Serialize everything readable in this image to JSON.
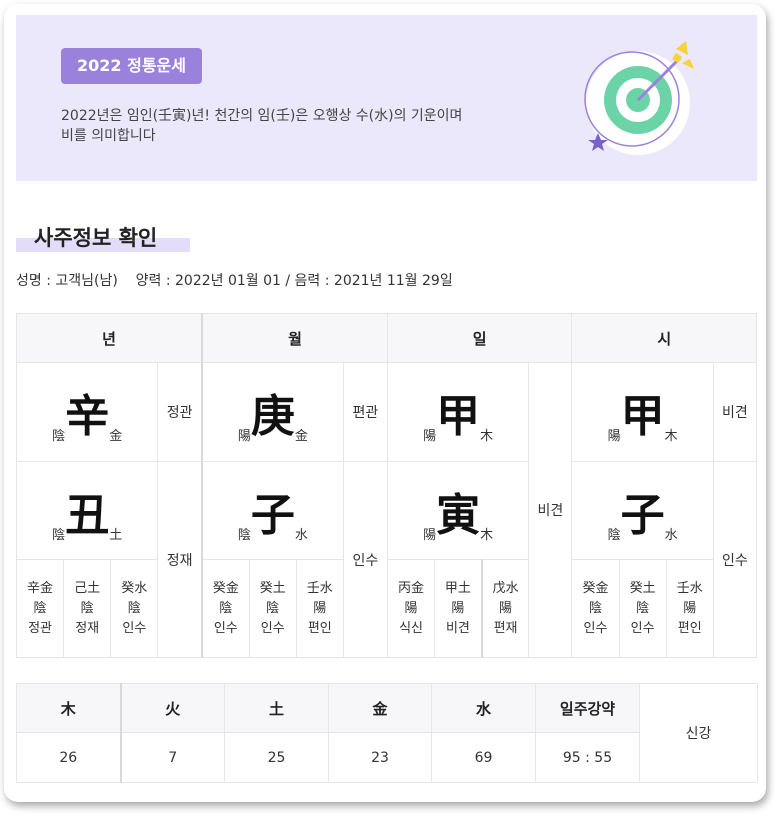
{
  "banner": {
    "badge": "2022 정통운세",
    "text_line1": "2022년은 임인(壬寅)년! 천간의 임(壬)은 오행상 수(水)의 기운이며",
    "text_line2": "비를 의미합니다"
  },
  "section": {
    "title": "사주정보 확인",
    "info": "성명 : 고객님(남)    양력 : 2022년 01월 01 / 음력 : 2021년 11월 29일"
  },
  "pillars": [
    {
      "header": "년",
      "stem": {
        "yin": "陰",
        "char": "辛",
        "elem": "金",
        "ten": "정관"
      },
      "branch": {
        "yin": "陰",
        "char": "丑",
        "elem": "土",
        "ten": "정재"
      },
      "hidden": [
        {
          "a": "辛金",
          "b": "陰",
          "c": "정관"
        },
        {
          "a": "己土",
          "b": "陰",
          "c": "정재"
        },
        {
          "a": "癸水",
          "b": "陰",
          "c": "인수"
        }
      ]
    },
    {
      "header": "월",
      "stem": {
        "yin": "陽",
        "char": "庚",
        "elem": "金",
        "ten": "편관"
      },
      "branch": {
        "yin": "陰",
        "char": "子",
        "elem": "水",
        "ten": "인수"
      },
      "hidden": [
        {
          "a": "癸金",
          "b": "陰",
          "c": "인수"
        },
        {
          "a": "癸土",
          "b": "陰",
          "c": "인수"
        },
        {
          "a": "壬水",
          "b": "陽",
          "c": "편인"
        }
      ]
    },
    {
      "header": "일",
      "stem": {
        "yin": "陽",
        "char": "甲",
        "elem": "木",
        "ten": ""
      },
      "branch": {
        "yin": "陽",
        "char": "寅",
        "elem": "木",
        "ten": "비견"
      },
      "hidden": [
        {
          "a": "丙金",
          "b": "陽",
          "c": "식신"
        },
        {
          "a": "甲土",
          "b": "陽",
          "c": "비견"
        },
        {
          "a": "戊水",
          "b": "陽",
          "c": "편재"
        }
      ]
    },
    {
      "header": "시",
      "stem": {
        "yin": "陽",
        "char": "甲",
        "elem": "木",
        "ten": "비견"
      },
      "branch": {
        "yin": "陰",
        "char": "子",
        "elem": "水",
        "ten": "인수"
      },
      "hidden": [
        {
          "a": "癸金",
          "b": "陰",
          "c": "인수"
        },
        {
          "a": "癸土",
          "b": "陰",
          "c": "인수"
        },
        {
          "a": "壬水",
          "b": "陽",
          "c": "편인"
        }
      ]
    }
  ],
  "ohang": {
    "headers": [
      "木",
      "火",
      "土",
      "金",
      "水",
      "일주강약"
    ],
    "values": [
      "26",
      "7",
      "25",
      "23",
      "69",
      "95 : 55"
    ],
    "result": "신강"
  },
  "colors": {
    "banner_bg": "#ebe8fc",
    "badge_bg": "#9a82dc",
    "target_green": "#6cd3a8",
    "arrow_yellow": "#f7d23a"
  }
}
